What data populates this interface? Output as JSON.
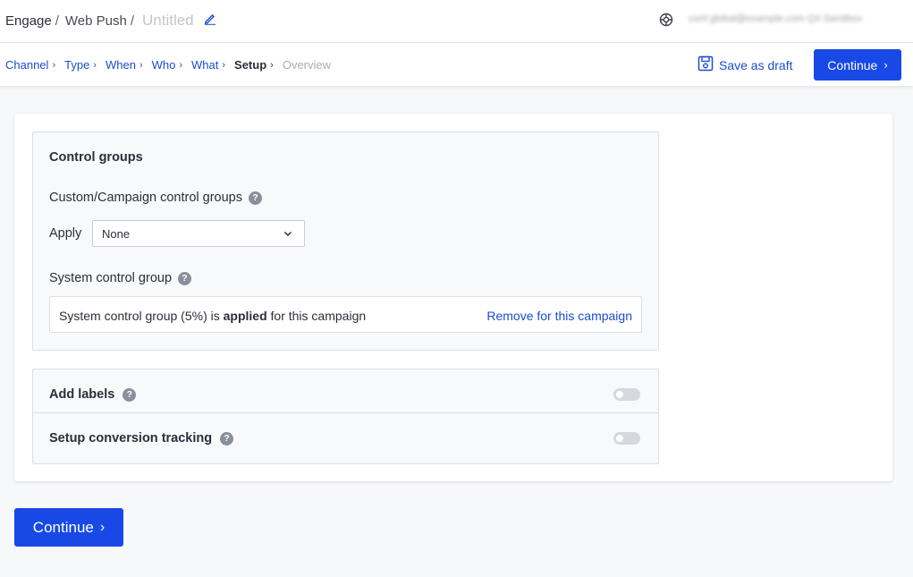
{
  "header": {
    "breadcrumb": [
      "Engage",
      "Web Push"
    ],
    "separator": "/",
    "campaign_title_placeholder": "Untitled",
    "account_text": "conf.global@example.com  Q4 Sandbox"
  },
  "steps": {
    "items": [
      {
        "label": "Channel",
        "state": "done"
      },
      {
        "label": "Type",
        "state": "done"
      },
      {
        "label": "When",
        "state": "done"
      },
      {
        "label": "Who",
        "state": "done"
      },
      {
        "label": "What",
        "state": "done"
      },
      {
        "label": "Setup",
        "state": "current"
      },
      {
        "label": "Overview",
        "state": "future"
      }
    ],
    "chevron": "›"
  },
  "actions": {
    "save_draft_label": "Save as draft",
    "continue_label": "Continue",
    "continue_chevron": "›"
  },
  "control_groups": {
    "title": "Control groups",
    "custom_title": "Custom/Campaign control groups",
    "apply_label": "Apply",
    "apply_selected": "None",
    "system_title": "System control group",
    "system_text_prefix": "System control group (5%) is ",
    "system_text_bold": "applied",
    "system_text_suffix": " for this campaign",
    "remove_link": "Remove for this campaign",
    "help_glyph": "?"
  },
  "options": {
    "add_labels": {
      "label": "Add labels",
      "enabled": false
    },
    "conversion": {
      "label": "Setup conversion tracking",
      "enabled": false
    }
  },
  "colors": {
    "primary": "#1849e6",
    "link": "#1a4dcf",
    "toggle_off": "#d5d8de"
  },
  "icons": {
    "edit": "pencil-icon",
    "help": "lifebuoy-icon",
    "save": "floppy-disk-icon",
    "dropdown": "chevron-down-icon"
  }
}
